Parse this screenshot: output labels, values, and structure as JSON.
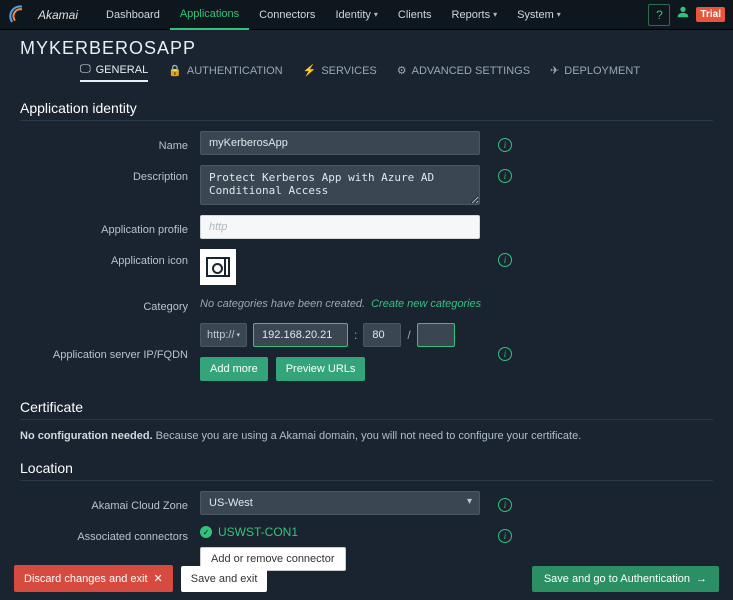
{
  "brand": "Akamai",
  "nav": {
    "dashboard": "Dashboard",
    "applications": "Applications",
    "connectors": "Connectors",
    "identity": "Identity",
    "clients": "Clients",
    "reports": "Reports",
    "system": "System"
  },
  "top_right": {
    "help": "?",
    "badge": "Trial"
  },
  "app_title": "MYKERBEROSAPP",
  "tabs": {
    "general": "GENERAL",
    "authentication": "AUTHENTICATION",
    "services": "SERVICES",
    "advanced": "ADVANCED SETTINGS",
    "deployment": "DEPLOYMENT"
  },
  "sections": {
    "identity_title": "Application identity",
    "certificate_title": "Certificate",
    "location_title": "Location"
  },
  "labels": {
    "name": "Name",
    "description": "Description",
    "profile": "Application profile",
    "icon": "Application icon",
    "category": "Category",
    "server": "Application server IP/FQDN",
    "cloud_zone": "Akamai Cloud Zone",
    "connectors": "Associated connectors"
  },
  "fields": {
    "name": "myKerberosApp",
    "description": "Protect Kerberos App with Azure AD Conditional Access",
    "profile_placeholder": "http",
    "category_empty": "No categories have been created.",
    "category_create": "Create new categories",
    "server_proto": "http://",
    "server_ip": "192.168.20.21",
    "server_port_sep": ":",
    "server_port": "80",
    "server_path_sep": "/",
    "server_path": "",
    "add_more": "Add more",
    "preview_urls": "Preview URLs",
    "cloud_zone": "US-West",
    "connector_name": "USWST-CON1",
    "connector_btn": "Add or remove connector"
  },
  "certificate": {
    "bold": "No configuration needed.",
    "rest": " Because you are using a Akamai domain, you will not need to configure your certificate."
  },
  "footer": {
    "discard": "Discard changes and exit",
    "save_exit": "Save and exit",
    "save_next": "Save and go to Authentication"
  }
}
